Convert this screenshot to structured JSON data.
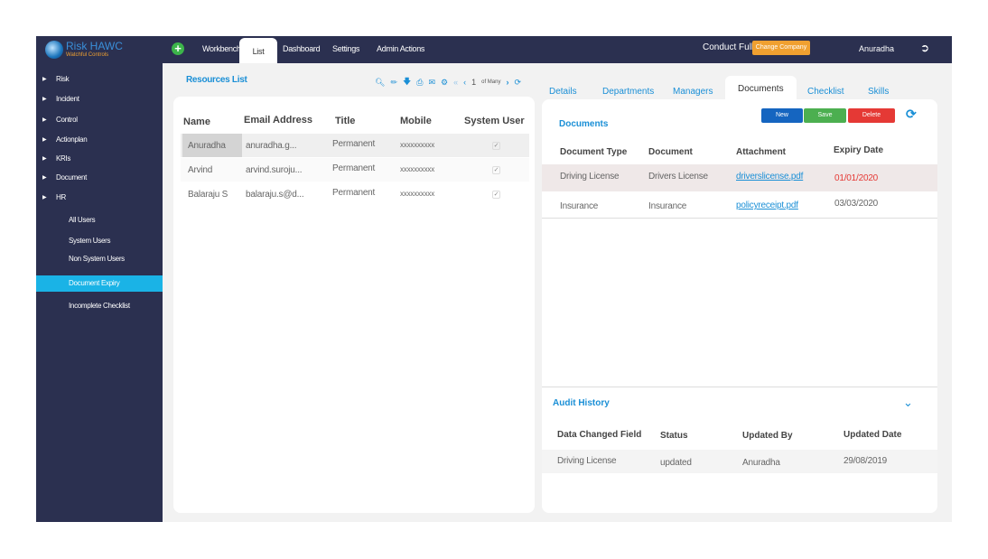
{
  "app": {
    "logo_title": "Risk HAWC",
    "logo_subtitle": "Watchful Controls"
  },
  "topnav": {
    "items": [
      "Workbench",
      "List",
      "Dashboard",
      "Settings",
      "Admin Actions"
    ],
    "active": "List",
    "company": "Conduct Full",
    "change_company": "Change Company",
    "user": "Anuradha"
  },
  "sidebar": {
    "items": [
      "Risk",
      "Incident",
      "Control",
      "Actionplan",
      "KRIs",
      "Document",
      "HR"
    ],
    "subitems": [
      "All Users",
      "System Users",
      "Non System Users",
      "Document Expiry",
      "Incomplete Checklist"
    ],
    "selected": "Document Expiry"
  },
  "resources": {
    "title": "Resources List",
    "page": "1",
    "page_of": "of Many",
    "columns": [
      "Name",
      "Email Address",
      "Title",
      "Mobile",
      "System User"
    ],
    "rows": [
      {
        "name": "Anuradha",
        "email": "anuradha.g...",
        "title": "Permanent",
        "mobile": "xxxxxxxxxx",
        "system_user": true
      },
      {
        "name": "Arvind",
        "email": "arvind.suroju...",
        "title": "Permanent",
        "mobile": "xxxxxxxxxx",
        "system_user": true
      },
      {
        "name": "Balaraju S",
        "email": "balaraju.s@d...",
        "title": "Permanent",
        "mobile": "xxxxxxxxxx",
        "system_user": true
      }
    ]
  },
  "tabs": [
    "Details",
    "Departments",
    "Managers",
    "Documents",
    "Checklist",
    "Skills"
  ],
  "documents": {
    "title": "Documents",
    "buttons": {
      "new": "New",
      "save": "Save",
      "delete": "Delete"
    },
    "columns": [
      "Document Type",
      "Document",
      "Attachment",
      "Expiry Date"
    ],
    "rows": [
      {
        "type": "Driving License",
        "document": "Drivers License",
        "attachment": "driverslicense.pdf",
        "expiry": "01/01/2020",
        "expired": true
      },
      {
        "type": "Insurance",
        "document": "Insurance",
        "attachment": "policyreceipt.pdf",
        "expiry": "03/03/2020",
        "expired": false
      }
    ]
  },
  "audit": {
    "title": "Audit History",
    "columns": [
      "Data Changed Field",
      "Status",
      "Updated By",
      "Updated Date"
    ],
    "rows": [
      {
        "field": "Driving License",
        "status": "updated",
        "by": "Anuradha",
        "date": "29/08/2019"
      }
    ]
  },
  "colors": {
    "nav": "#2b3050",
    "accent": "#1ab3e6",
    "new": "#1565c0",
    "save": "#4caf50",
    "delete": "#e53935",
    "change_company": "#f0a030",
    "expired": "#e53935"
  }
}
